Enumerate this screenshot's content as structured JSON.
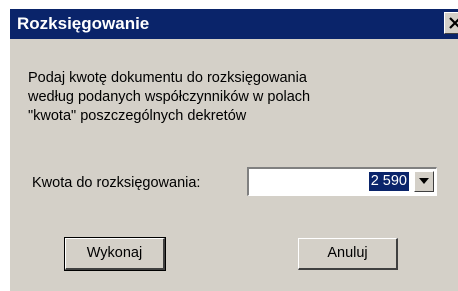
{
  "window": {
    "title": "Rozksięgowanie",
    "close_icon": "close-icon"
  },
  "message": {
    "lines": [
      "Podaj kwotę dokumentu do rozksięgowania",
      "według podanych współczynników w polach",
      "\"kwota\" poszczególnych dekretów"
    ]
  },
  "amount": {
    "label": "Kwota do rozksięgowania:",
    "value": "2 590",
    "dropdown_icon": "chevron-down-icon"
  },
  "buttons": {
    "execute_label": "Wykonaj",
    "cancel_label": "Anuluj"
  },
  "colors": {
    "titlebar": "#0a246a",
    "dialog_face": "#d4d0c8",
    "selection": "#0a246a"
  }
}
